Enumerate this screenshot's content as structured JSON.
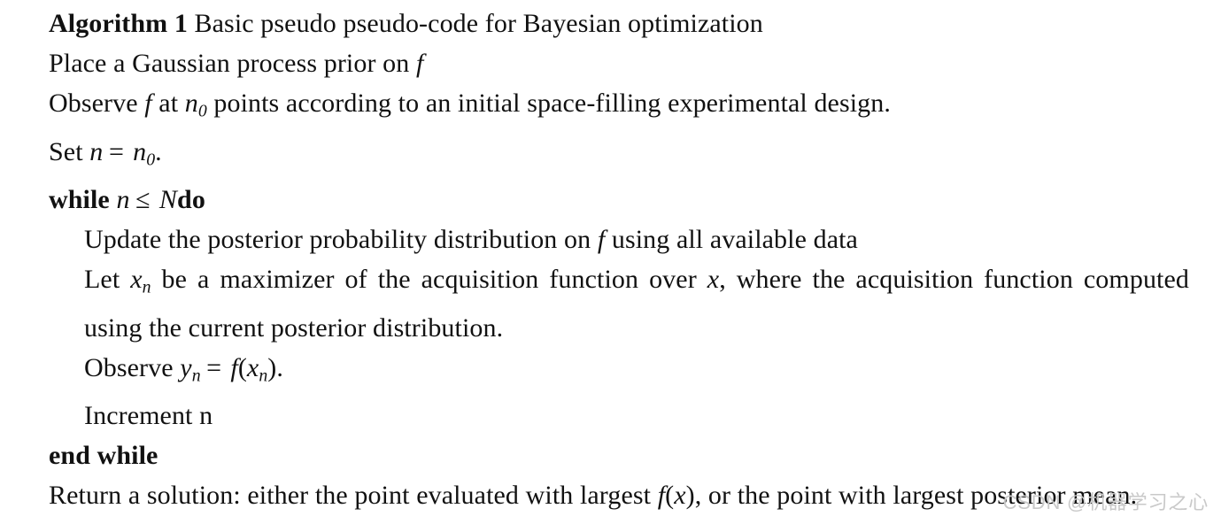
{
  "document": {
    "type": "algorithm-pseudocode-block",
    "background_color": "#ffffff",
    "text_color": "#111111"
  },
  "algorithm": {
    "header": {
      "label": "Algorithm 1",
      "title": "Basic pseudo pseudo-code for Bayesian optimization"
    },
    "lines": [
      {
        "id": "line-place-prior",
        "indent": 0,
        "text_plain": "Place a Gaussian process prior on f",
        "parts": {
          "a": "Place a Gaussian process prior on ",
          "var_f": "f"
        }
      },
      {
        "id": "line-observe-initial",
        "indent": 0,
        "text_plain": "Observe f at n0 points according to an initial space-filling experimental design.",
        "parts": {
          "a": "Observe ",
          "var_f": "f",
          "b": " at ",
          "var_n": "n",
          "sub_0": "0",
          "c": " points according to an initial space-filling experimental design."
        }
      },
      {
        "id": "line-set-n",
        "indent": 0,
        "text_plain": "Set n = n0.",
        "parts": {
          "a": "Set ",
          "var_n": "n",
          "eq": "=",
          "var_n2": "n",
          "sub_0": "0",
          "period": "."
        }
      },
      {
        "id": "line-while",
        "indent": 0,
        "text_plain": "while n ≤ Ndo",
        "parts": {
          "kw_while": "while",
          "var_n": "n",
          "le": "≤",
          "var_N": "N",
          "kw_do": "do"
        }
      },
      {
        "id": "line-update-posterior",
        "indent": 1,
        "text_plain": "Update the posterior probability distribution on f using all available data",
        "parts": {
          "a": "Update the posterior probability distribution on ",
          "var_f": "f",
          "b": " using all available data"
        }
      },
      {
        "id": "line-let-xn",
        "indent": 1,
        "text_plain": "Let xn be a maximizer of the acquisition function over x, where the acquisition function computed using the current posterior distribution.",
        "parts": {
          "a": "Let ",
          "var_x": "x",
          "sub_n": "n",
          "b": " be a maximizer of the acquisition function over ",
          "var_x2": "x",
          "c": ", where the acquisition function computed using the current posterior distribution."
        }
      },
      {
        "id": "line-observe-yn",
        "indent": 1,
        "text_plain": "Observe yn = f(xn).",
        "parts": {
          "a": "Observe ",
          "var_y": "y",
          "sub_n": "n",
          "eq": "=",
          "var_f": "f",
          "open_paren": "(",
          "var_x": "x",
          "sub_n2": "n",
          "close_paren": ")",
          "period": "."
        }
      },
      {
        "id": "line-increment-n",
        "indent": 1,
        "text_plain": "Increment n",
        "parts": {
          "a": "Increment n"
        }
      },
      {
        "id": "line-end-while",
        "indent": 0,
        "text_plain": "end while",
        "parts": {
          "kw": "end while"
        }
      },
      {
        "id": "line-return",
        "indent": 0,
        "text_plain": "Return a solution: either the point evaluated with largest f(x), or the point with largest posterior mean.",
        "parts": {
          "a": "Return a solution: either the point evaluated with largest ",
          "var_f": "f",
          "open_paren": "(",
          "var_x": "x",
          "close_paren": ")",
          "b": ", or the point with largest posterior mean."
        }
      }
    ]
  },
  "watermark": {
    "text": "CSDN @机器学习之心",
    "color": "#c9c9c9"
  }
}
